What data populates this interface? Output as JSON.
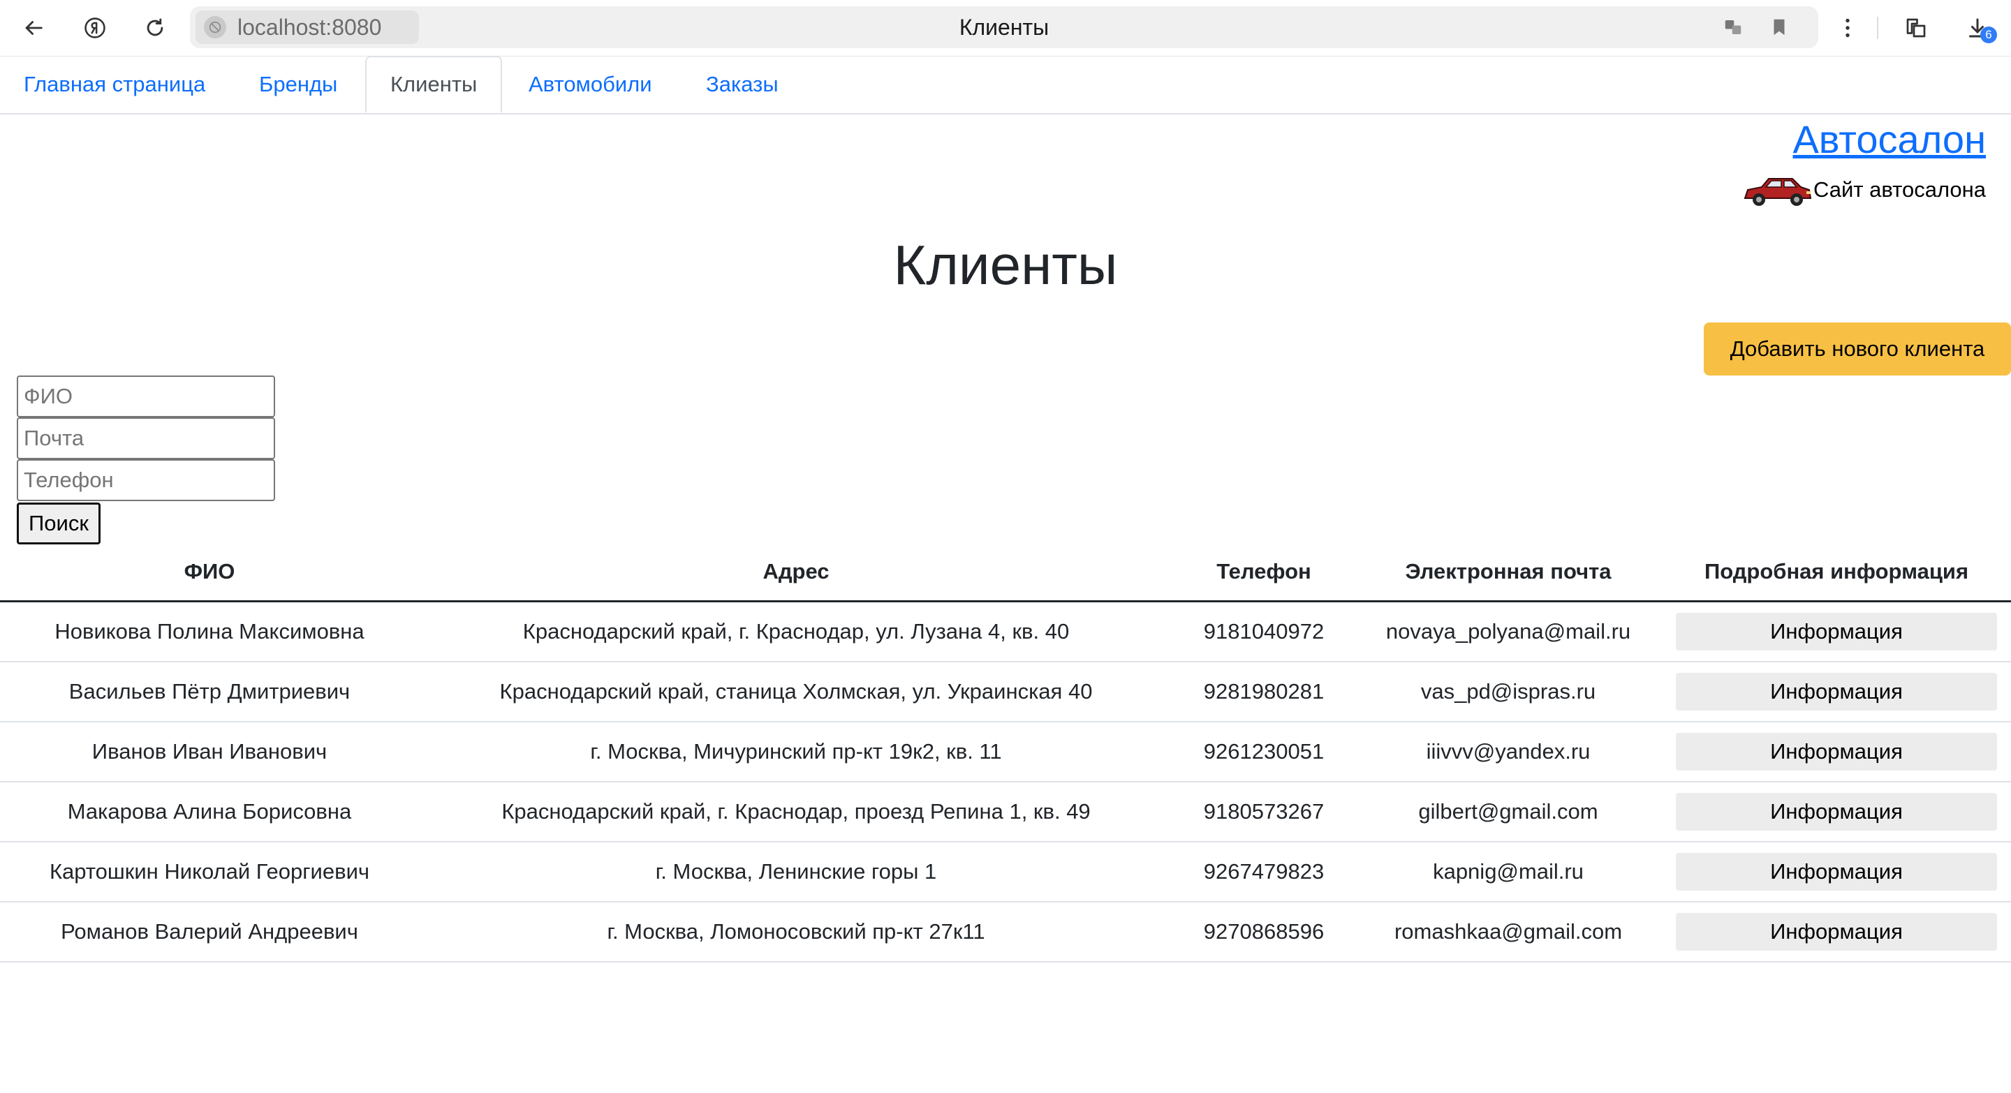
{
  "browser": {
    "url": "localhost:8080",
    "tab_title": "Клиенты",
    "download_count": "6"
  },
  "nav": {
    "tabs": [
      {
        "label": "Главная страница",
        "active": false
      },
      {
        "label": "Бренды",
        "active": false
      },
      {
        "label": "Клиенты",
        "active": true
      },
      {
        "label": "Автомобили",
        "active": false
      },
      {
        "label": "Заказы",
        "active": false
      }
    ]
  },
  "brand": {
    "title": "Автосалон",
    "subtitle": "Сайт автосалона",
    "car_color": "#b22222"
  },
  "page": {
    "title": "Клиенты",
    "add_button": "Добавить нового клиента",
    "accent_color": "#f7c044"
  },
  "search": {
    "name_placeholder": "ФИО",
    "email_placeholder": "Почта",
    "phone_placeholder": "Телефон",
    "submit_label": "Поиск"
  },
  "table": {
    "headers": [
      "ФИО",
      "Адрес",
      "Телефон",
      "Электронная почта",
      "Подробная информация"
    ],
    "rows": [
      {
        "name": "Новикова Полина Максимовна",
        "address": "Краснодарский край, г. Краснодар, ул. Лузана 4, кв. 40",
        "phone": "9181040972",
        "email": "novaya_polyana@mail.ru",
        "action": "Информация"
      },
      {
        "name": "Васильев Пётр Дмитриевич",
        "address": "Краснодарский край, станица Холмская, ул. Украинская 40",
        "phone": "9281980281",
        "email": "vas_pd@ispras.ru",
        "action": "Информация"
      },
      {
        "name": "Иванов Иван Иванович",
        "address": "г. Москва, Мичуринский пр-кт 19к2, кв. 11",
        "phone": "9261230051",
        "email": "iiivvv@yandex.ru",
        "action": "Информация"
      },
      {
        "name": "Макарова Алина Борисовна",
        "address": "Краснодарский край, г. Краснодар, проезд Репина 1, кв. 49",
        "phone": "9180573267",
        "email": "gilbert@gmail.com",
        "action": "Информация"
      },
      {
        "name": "Картошкин Николай Георгиевич",
        "address": "г. Москва, Ленинские горы 1",
        "phone": "9267479823",
        "email": "kapnig@mail.ru",
        "action": "Информация"
      },
      {
        "name": "Романов Валерий Андреевич",
        "address": "г. Москва, Ломоносовский пр-кт 27к11",
        "phone": "9270868596",
        "email": "romashkaa@gmail.com",
        "action": "Информация"
      }
    ]
  }
}
